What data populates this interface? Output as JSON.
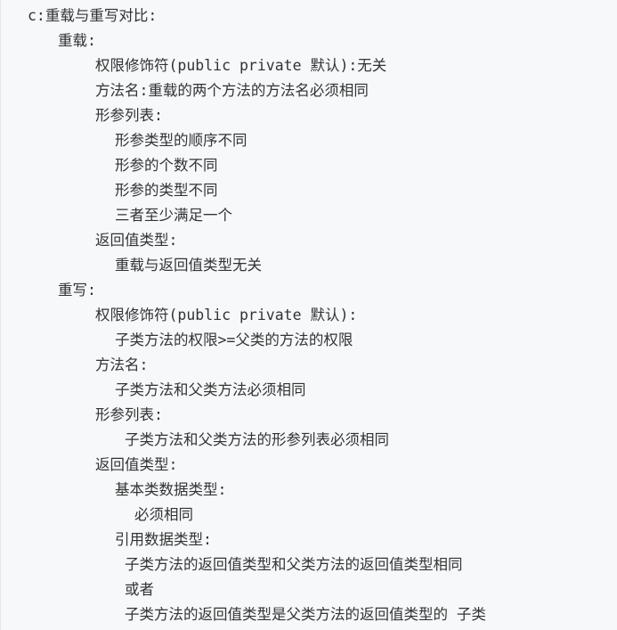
{
  "lines": [
    "c:重载与重写对比:",
    "重载:",
    "权限修饰符(public private 默认):无关",
    "方法名:重载的两个方法的方法名必须相同",
    "形参列表:",
    "形参类型的顺序不同",
    "形参的个数不同",
    "形参的类型不同",
    "三者至少满足一个",
    "返回值类型:",
    "重载与返回值类型无关",
    "重写:",
    "权限修饰符(public private 默认):",
    "子类方法的权限>=父类的方法的权限",
    "方法名:",
    "子类方法和父类方法必须相同",
    "形参列表:",
    "子类方法和父类方法的形参列表必须相同",
    "返回值类型:",
    "基本类数据类型:",
    "必须相同",
    "引用数据类型:",
    "子类方法的返回值类型和父类方法的返回值类型相同",
    "或者",
    "子类方法的返回值类型是父类方法的返回值类型的 子类"
  ]
}
